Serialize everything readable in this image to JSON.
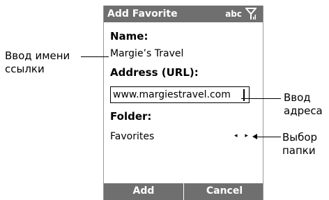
{
  "window": {
    "title": "Add Favorite",
    "input_mode": "abc"
  },
  "form": {
    "name_label": "Name:",
    "name_value": "Margie’s Travel",
    "url_label": "Address (URL):",
    "url_value": "www.margiestravel.com",
    "folder_label": "Folder:",
    "folder_value": "Favorites",
    "folder_arrows": "◂ ▸"
  },
  "softkeys": {
    "left": "Add",
    "right": "Cancel"
  },
  "callouts": {
    "name_line1": "Ввод имени",
    "name_line2": "ссылки",
    "url_line1": "Ввод",
    "url_line2": "адреса",
    "folder_line1": "Выбор",
    "folder_line2": "папки"
  },
  "icons": {
    "signal": "signal-antenna-icon",
    "folder_arrows": "left-right-arrows-icon"
  }
}
